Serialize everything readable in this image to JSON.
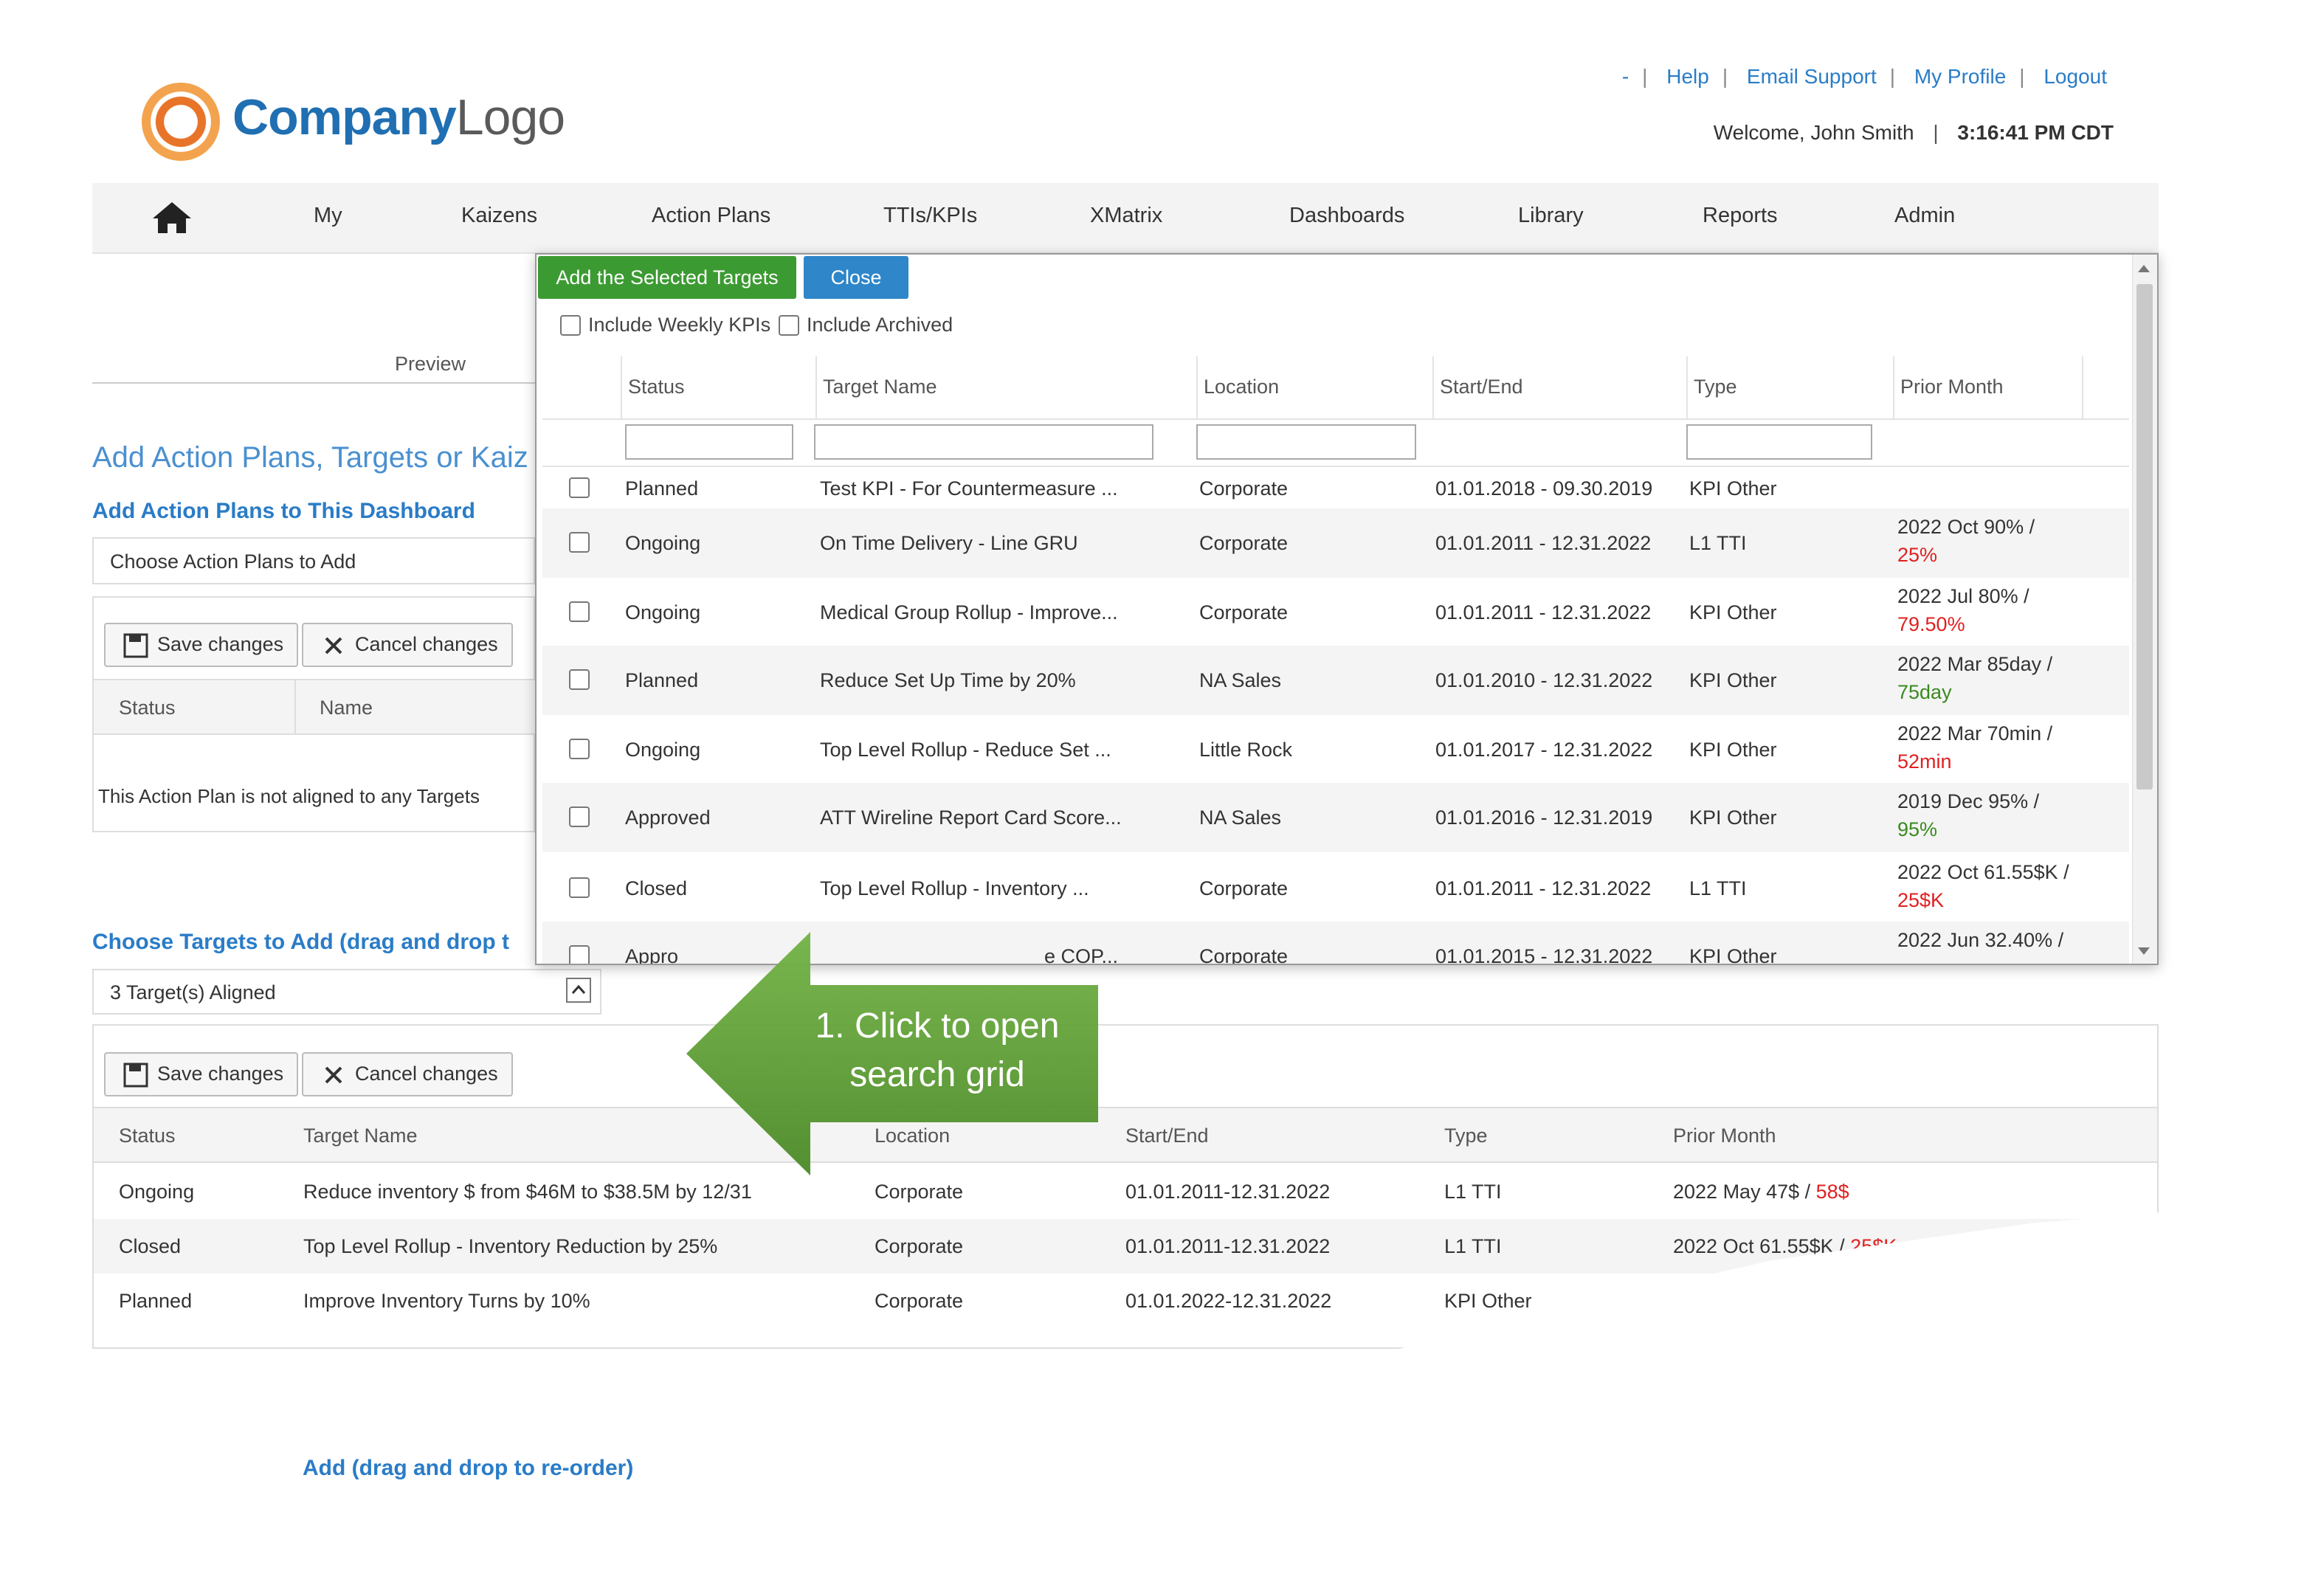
{
  "header": {
    "logo_part1": "Company",
    "logo_part2": "Logo",
    "toplinks": [
      "-",
      "Help",
      "Email Support",
      "My Profile",
      "Logout"
    ],
    "welcome": "Welcome, John Smith",
    "time": "3:16:41 PM CDT"
  },
  "nav": {
    "items": [
      "My",
      "Kaizens",
      "Action Plans",
      "TTIs/KPIs",
      "XMatrix",
      "Dashboards",
      "Library",
      "Reports",
      "Admin"
    ]
  },
  "page": {
    "preview_tab": "Preview",
    "main_title": "Add Action Plans, Targets or Kaiz",
    "ap_section_title": "Add Action Plans to This Dashboard",
    "ap_select": "Choose Action Plans to Add",
    "save_label": "Save changes",
    "cancel_label": "Cancel changes",
    "ap_headers": [
      "Status",
      "Name"
    ],
    "ap_empty": "This Action Plan is not aligned to any Targets",
    "targets_section_title": "Choose Targets to Add (drag and drop t",
    "targets_select": "3 Target(s) Aligned",
    "targets_headers": [
      "Status",
      "Target Name",
      "Location",
      "Start/End",
      "Type",
      "Prior Month"
    ],
    "targets_rows": [
      {
        "status": "Ongoing",
        "name": "Reduce inventory $ from $46M to $38.5M by 12/31",
        "location": "Corporate",
        "dates": "01.01.2011-12.31.2022",
        "type": "L1 TTI",
        "prior_a": "2022 May 47$ / ",
        "prior_b": "58$"
      },
      {
        "status": "Closed",
        "name": "Top Level Rollup - Inventory Reduction by 25%",
        "location": "Corporate",
        "dates": "01.01.2011-12.31.2022",
        "type": "L1 TTI",
        "prior_a": "2022 Oct 61.55$K / ",
        "prior_b": "25$K"
      },
      {
        "status": "Planned",
        "name": "Improve Inventory Turns by 10%",
        "location": "Corporate",
        "dates": "01.01.2022-12.31.2022",
        "type": "KPI Other",
        "prior_a": "",
        "prior_b": ""
      }
    ],
    "bottom_section_title": "Add (drag and drop to re-order)"
  },
  "modal": {
    "add_button": "Add the Selected Targets",
    "close_button": "Close",
    "include_weekly": "Include Weekly KPIs",
    "include_archived": "Include Archived",
    "headers": [
      "Status",
      "Target Name",
      "Location",
      "Start/End",
      "Type",
      "Prior Month"
    ],
    "rows": [
      {
        "status": "Planned",
        "name": "Test KPI - For Countermeasure ...",
        "location": "Corporate",
        "dates": "01.01.2018 - 09.30.2019",
        "type": "KPI Other",
        "prior_a": "",
        "prior_b": ""
      },
      {
        "status": "Ongoing",
        "name": "On Time Delivery - Line GRU",
        "location": "Corporate",
        "dates": "01.01.2011 - 12.31.2022",
        "type": "L1 TTI",
        "prior_a": "2022 Oct 90% /",
        "prior_b": "25%"
      },
      {
        "status": "Ongoing",
        "name": "Medical Group Rollup - Improve...",
        "location": "Corporate",
        "dates": "01.01.2011 - 12.31.2022",
        "type": "KPI Other",
        "prior_a": "2022 Jul 80% /",
        "prior_b": "79.50%"
      },
      {
        "status": "Planned",
        "name": "Reduce Set Up Time by 20%",
        "location": "NA Sales",
        "dates": "01.01.2010 - 12.31.2022",
        "type": "KPI Other",
        "prior_a": "2022 Mar 85day /",
        "prior_b": "75day"
      },
      {
        "status": "Ongoing",
        "name": "Top Level Rollup - Reduce Set ...",
        "location": "Little Rock",
        "dates": "01.01.2017 - 12.31.2022",
        "type": "KPI Other",
        "prior_a": "2022 Mar 70min /",
        "prior_b": "52min"
      },
      {
        "status": "Approved",
        "name": "ATT Wireline Report Card Score...",
        "location": "NA Sales",
        "dates": "01.01.2016 - 12.31.2019",
        "type": "KPI Other",
        "prior_a": "2019 Dec 95% /",
        "prior_b": "95%"
      },
      {
        "status": "Closed",
        "name": "Top Level Rollup - Inventory ...",
        "location": "Corporate",
        "dates": "01.01.2011 - 12.31.2022",
        "type": "L1 TTI",
        "prior_a": "2022 Oct 61.55$K /",
        "prior_b": "25$K"
      },
      {
        "status": "Appro",
        "name": "e COP...",
        "location": "Corporate",
        "dates": "01.01.2015 - 12.31.2022",
        "type": "KPI Other",
        "prior_a": "2022 Jun 32.40% /",
        "prior_b": ""
      }
    ]
  },
  "callout": {
    "line1": "1. Click to open",
    "line2": "search grid"
  },
  "colors": {
    "link": "#2a7cc7",
    "green_button": "#3c9a32",
    "blue_button": "#2f86c9",
    "callout_green": "#5f9e37",
    "bad_value": "#e02020",
    "good_value": "#3a8a1e"
  }
}
